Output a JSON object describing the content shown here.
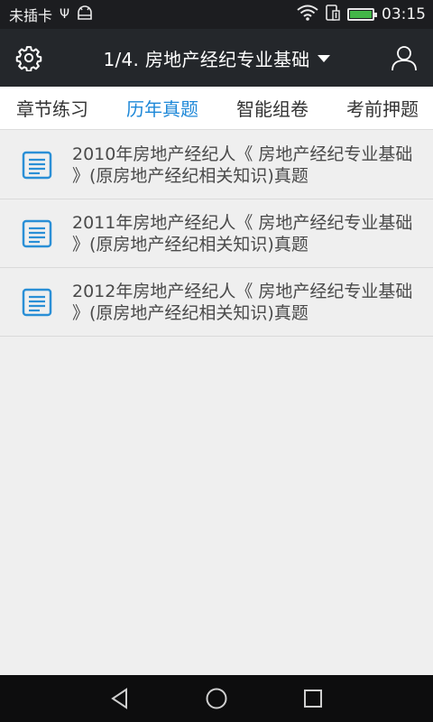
{
  "status": {
    "carrier": "未插卡",
    "usb_symbol": "Ψ",
    "time": "03:15",
    "battery_level": 1.0
  },
  "app_bar": {
    "title": "1/4. 房地产经纪专业基础"
  },
  "tabs": [
    {
      "label": "章节练习",
      "active": false
    },
    {
      "label": "历年真题",
      "active": true
    },
    {
      "label": "智能组卷",
      "active": false
    },
    {
      "label": "考前押题",
      "active": false
    }
  ],
  "exams": [
    {
      "title": "2010年房地产经纪人《 房地产经纪专业基础 》(原房地产经纪相关知识)真题"
    },
    {
      "title": "2011年房地产经纪人《 房地产经纪专业基础 》(原房地产经纪相关知识)真题"
    },
    {
      "title": "2012年房地产经纪人《 房地产经纪专业基础 》(原房地产经纪相关知识)真题"
    }
  ],
  "colors": {
    "accent": "#1e88d8",
    "icon_blue": "#2a8fd6",
    "status_bar": "#1c1d20",
    "app_bar": "#24272b",
    "battery_green": "#43b648"
  }
}
